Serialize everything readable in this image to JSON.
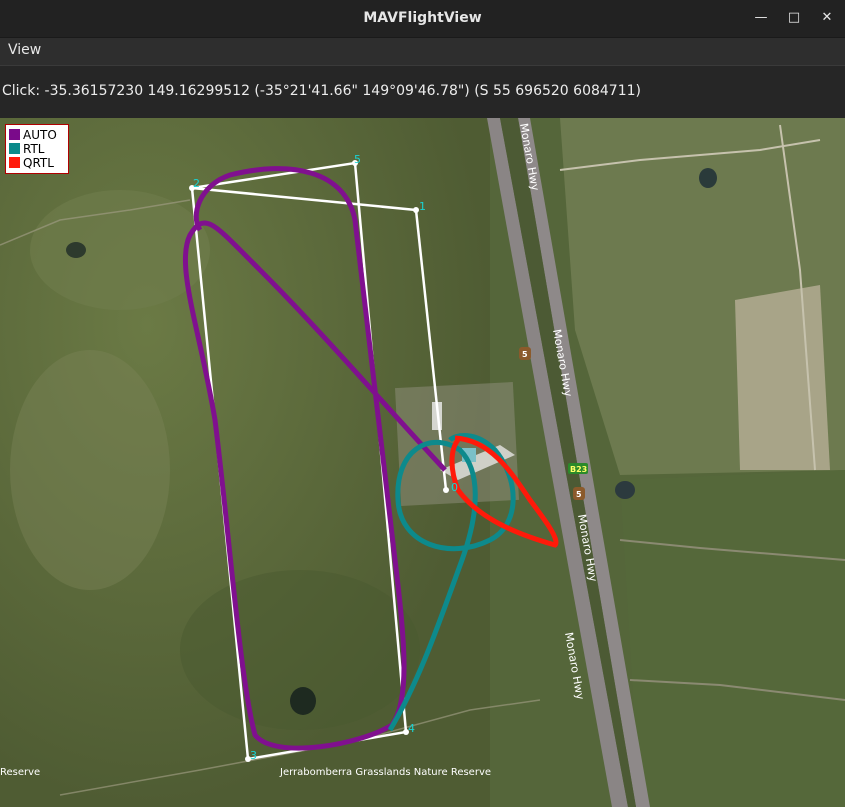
{
  "window": {
    "title": "MAVFlightView",
    "minimize_icon": "minimize-icon",
    "maximize_icon": "maximize-icon",
    "close_icon": "close-icon"
  },
  "menu": {
    "view_label": "View"
  },
  "status": {
    "click_text": "Click: -35.36157230 149.16299512 (-35°21'41.66\" 149°09'46.78\") (S 55 696520 6084711)"
  },
  "legend": {
    "items": [
      {
        "label": "AUTO",
        "color": "#7a0a8a"
      },
      {
        "label": "RTL",
        "color": "#0a8a8a"
      },
      {
        "label": "QRTL",
        "color": "#ff1a0a"
      }
    ]
  },
  "map": {
    "road_labels": [
      "Monaro Hwy",
      "Monaro Hwy",
      "Monaro Hwy",
      "Monaro Hwy"
    ],
    "route_shields": [
      "5",
      "5",
      "B23"
    ],
    "place_labels": [
      "Jerrabomberra Grasslands Nature Reserve",
      "Reserve"
    ],
    "waypoints": [
      "1",
      "2",
      "3",
      "4",
      "5"
    ],
    "home_label": "0",
    "colors": {
      "grass": "#5a6a3a",
      "road": "#8e8a8a",
      "mission_line": "#ffffff",
      "waypoint_label": "#19d3d3"
    }
  }
}
